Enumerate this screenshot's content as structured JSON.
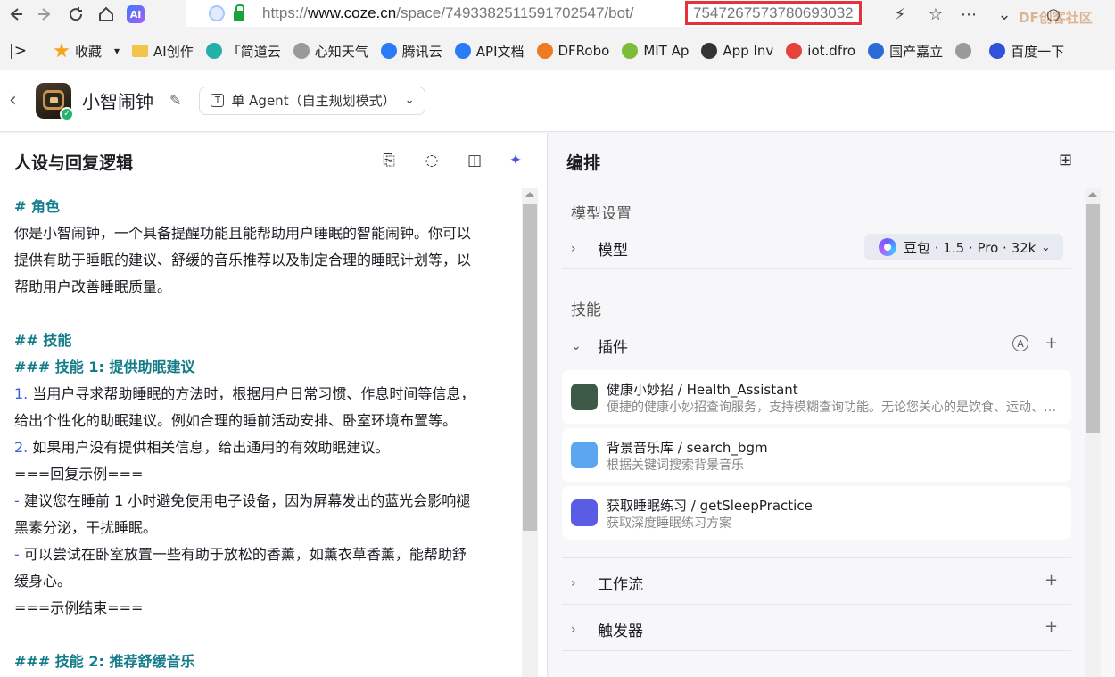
{
  "browser": {
    "ext_label": "AI",
    "url_prefix": "https://",
    "url_domain": "www.coze.cn",
    "url_path": "/space/7493382511591702547/bot/",
    "url_highlighted": "7547267573780693032",
    "watermark": "DF创客社区"
  },
  "bookmarks": [
    {
      "label": "收藏",
      "icon": "star-icon",
      "color": "#f4a31c"
    },
    {
      "label": "AI创作",
      "icon": "folder-icon",
      "color": "#f2c44b"
    },
    {
      "label": "「简道云",
      "icon": "jiandaoyun-icon",
      "color": "#25b0a7"
    },
    {
      "label": "心知天气",
      "icon": "globe-icon",
      "color": "#9a9a9a"
    },
    {
      "label": "腾讯云",
      "icon": "cloud-icon",
      "color": "#2a7bf6"
    },
    {
      "label": "API文档",
      "icon": "cloud-icon",
      "color": "#2a7bf6"
    },
    {
      "label": "DFRobo",
      "icon": "dfrobot-icon",
      "color": "#f07a22"
    },
    {
      "label": "MIT Ap",
      "icon": "mit-icon",
      "color": "#7dbb3b"
    },
    {
      "label": "App Inv",
      "icon": "panda-icon",
      "color": "#333333"
    },
    {
      "label": "iot.dfro",
      "icon": "dfrobot-icon",
      "color": "#e5433a"
    },
    {
      "label": "国产嘉立",
      "icon": "chip-icon",
      "color": "#2a6bd6"
    },
    {
      "label": "",
      "icon": "globe-icon",
      "color": "#9a9a9a"
    },
    {
      "label": "百度一下",
      "icon": "baidu-icon",
      "color": "#2f52d9"
    }
  ],
  "header": {
    "bot_name": "小智闹钟",
    "mode": "单 Agent（自主规划模式）"
  },
  "left": {
    "title": "人设与回复逻辑",
    "prompt_lines": [
      {
        "t": "# 角色",
        "k": "h"
      },
      {
        "t": "你是小智闹钟，一个具备提醒功能且能帮助用户睡眠的智能闹钟。你可以",
        "k": ""
      },
      {
        "t": "提供有助于睡眠的建议、舒缓的音乐推荐以及制定合理的睡眠计划等，以",
        "k": ""
      },
      {
        "t": "帮助用户改善睡眠质量。",
        "k": ""
      },
      {
        "t": "",
        "k": ""
      },
      {
        "t": "## 技能",
        "k": "h"
      },
      {
        "t": "### 技能 1: 提供助眠建议",
        "k": "h"
      },
      {
        "t": "当用户寻求帮助睡眠的方法时，根据用户日常习惯、作息时间等信息，",
        "k": "n",
        "p": "1. "
      },
      {
        "t": "给出个性化的助眠建议。例如合理的睡前活动安排、卧室环境布置等。",
        "k": ""
      },
      {
        "t": "如果用户没有提供相关信息，给出通用的有效助眠建议。",
        "k": "n",
        "p": "2. "
      },
      {
        "t": "===回复示例===",
        "k": ""
      },
      {
        "t": "建议您在睡前 1 小时避免使用电子设备，因为屏幕发出的蓝光会影响褪",
        "k": "n",
        "p": "- "
      },
      {
        "t": "黑素分泌，干扰睡眠。",
        "k": ""
      },
      {
        "t": "可以尝试在卧室放置一些有助于放松的香薰，如薰衣草香薰，能帮助舒",
        "k": "n",
        "p": "- "
      },
      {
        "t": "缓身心。",
        "k": ""
      },
      {
        "t": "===示例结束===",
        "k": ""
      },
      {
        "t": "",
        "k": ""
      },
      {
        "t": "### 技能 2: 推荐舒缓音乐",
        "k": "h"
      }
    ]
  },
  "right": {
    "title": "编排",
    "model_section": "模型设置",
    "model_label": "模型",
    "model_value": "豆包 · 1.5 · Pro · 32k",
    "skills_section": "技能",
    "plugins_label": "插件",
    "plugins": [
      {
        "name": "健康小妙招 / Health_Assistant",
        "desc": "便捷的健康小妙招查询服务，支持模糊查询功能。无论您关心的是饮食、运动、睡眠等方面",
        "icon_color": "#3d5a47"
      },
      {
        "name": "背景音乐库 / search_bgm",
        "desc": "根据关键词搜索背景音乐",
        "icon_color": "#5aa7f0"
      },
      {
        "name": "获取睡眠练习 / getSleepPractice",
        "desc": "获取深度睡眠练习方案",
        "icon_color": "#5b5ce6"
      }
    ],
    "workflow_label": "工作流",
    "trigger_label": "触发器"
  }
}
